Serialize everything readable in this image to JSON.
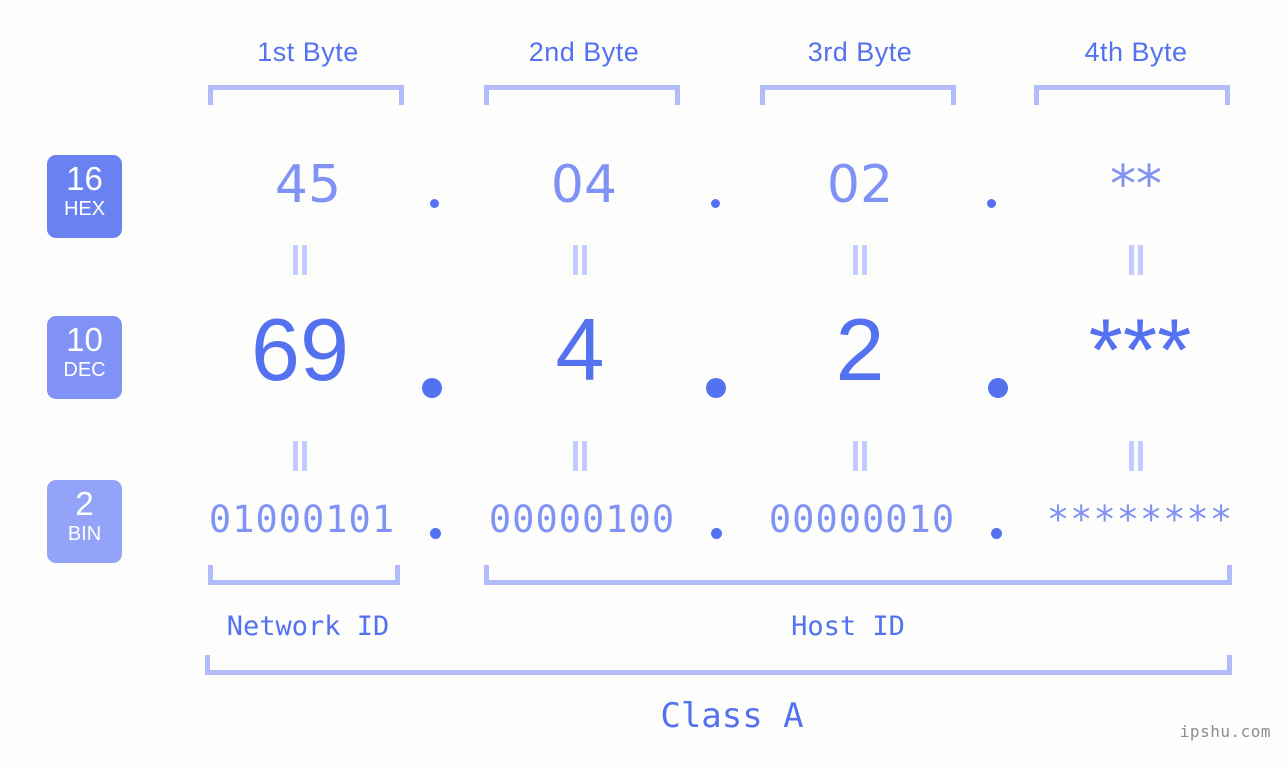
{
  "header": {
    "byte_labels": [
      "1st Byte",
      "2nd Byte",
      "3rd Byte",
      "4th Byte"
    ]
  },
  "bases": [
    {
      "num": "16",
      "abbr": "HEX",
      "color": "#6a81f2"
    },
    {
      "num": "10",
      "abbr": "DEC",
      "color": "#8092f5"
    },
    {
      "num": "2",
      "abbr": "BIN",
      "color": "#93a4f8"
    }
  ],
  "rows": {
    "hex": {
      "values": [
        "45",
        "04",
        "02",
        "**"
      ]
    },
    "dec": {
      "values": [
        "69",
        "4",
        "2",
        "***"
      ]
    },
    "bin": {
      "values": [
        "01000101",
        "00000100",
        "00000010",
        "********"
      ]
    }
  },
  "separator": ".",
  "footer": {
    "network_id": "Network ID",
    "host_id": "Host ID",
    "class_label": "Class A"
  },
  "watermark": "ipshu.com",
  "colors": {
    "background": "#fdfefb",
    "accent": "#5471f0",
    "accent_light": "#8092f5",
    "bracket": "#b3bcfb",
    "eq_mark": "#c2caff",
    "watermark": "#8d8d8d"
  }
}
